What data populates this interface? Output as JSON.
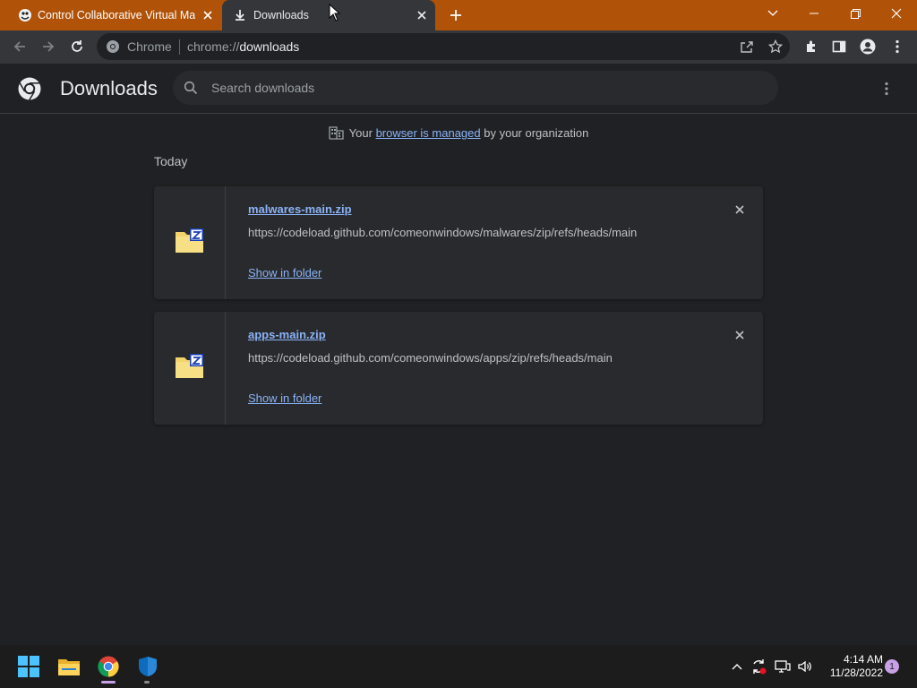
{
  "colors": {
    "tab_strip": "#b05208",
    "toolbar": "#35363a",
    "page_bg": "#202124",
    "card_bg": "#292a2d",
    "link": "#8ab4f8"
  },
  "tabs": [
    {
      "title": "Control Collaborative Virtual Mac",
      "icon": "vm-control-icon",
      "active": false
    },
    {
      "title": "Downloads",
      "icon": "download-icon",
      "active": true
    }
  ],
  "omnibox": {
    "site_chip": "Chrome",
    "url_scheme": "chrome://",
    "url_path": "downloads"
  },
  "header": {
    "title": "Downloads",
    "search_placeholder": "Search downloads"
  },
  "managed_notice": {
    "prefix": "Your",
    "link": "browser is managed",
    "suffix": "by your organization"
  },
  "day_label": "Today",
  "downloads": [
    {
      "file_name": "malwares-main.zip",
      "url": "https://codeload.github.com/comeonwindows/malwares/zip/refs/heads/main",
      "action": "Show in folder",
      "icon": "zip-file-icon"
    },
    {
      "file_name": "apps-main.zip",
      "url": "https://codeload.github.com/comeonwindows/apps/zip/refs/heads/main",
      "action": "Show in folder",
      "icon": "zip-file-icon"
    }
  ],
  "taskbar": {
    "apps": [
      "start-icon",
      "file-explorer-icon",
      "chrome-icon",
      "windows-security-icon"
    ],
    "time": "4:14 AM",
    "date": "11/28/2022",
    "notification_count": "1"
  }
}
